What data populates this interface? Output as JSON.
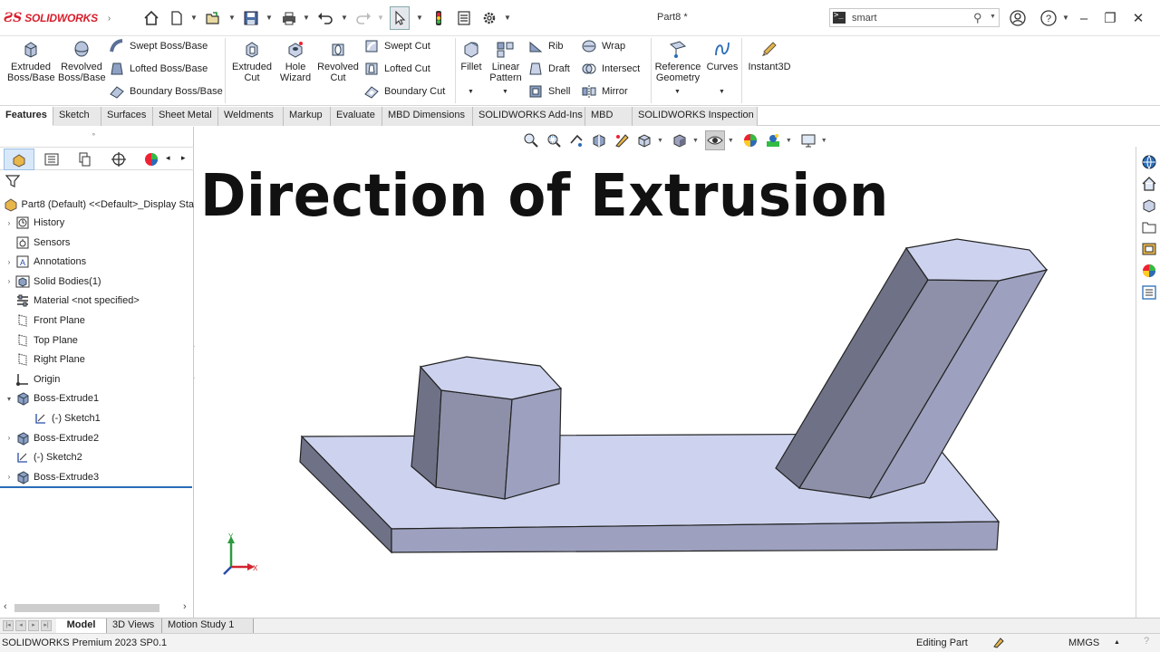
{
  "app": {
    "brand": "SOLIDWORKS",
    "doc_title": "Part8 *"
  },
  "search": {
    "value": "smart"
  },
  "ribbon": {
    "extruded_boss": "Extruded\nBoss/Base",
    "revolved_boss": "Revolved\nBoss/Base",
    "swept_boss": "Swept Boss/Base",
    "lofted_boss": "Lofted Boss/Base",
    "boundary_boss": "Boundary Boss/Base",
    "extruded_cut": "Extruded\nCut",
    "hole_wizard": "Hole\nWizard",
    "revolved_cut": "Revolved\nCut",
    "swept_cut": "Swept Cut",
    "lofted_cut": "Lofted Cut",
    "boundary_cut": "Boundary Cut",
    "fillet": "Fillet",
    "linear_pattern": "Linear\nPattern",
    "rib": "Rib",
    "draft": "Draft",
    "shell": "Shell",
    "wrap": "Wrap",
    "intersect": "Intersect",
    "mirror": "Mirror",
    "reference_geometry": "Reference\nGeometry",
    "curves": "Curves",
    "instant3d": "Instant3D"
  },
  "tabs": [
    "Features",
    "Sketch",
    "Surfaces",
    "Sheet Metal",
    "Weldments",
    "Markup",
    "Evaluate",
    "MBD Dimensions",
    "SOLIDWORKS Add-Ins",
    "MBD",
    "SOLIDWORKS Inspection"
  ],
  "tree": {
    "root": "Part8 (Default) <<Default>_Display Sta",
    "items": [
      {
        "label": "History",
        "icon": "history-icon",
        "expandable": true
      },
      {
        "label": "Sensors",
        "icon": "sensors-icon",
        "expandable": false
      },
      {
        "label": "Annotations",
        "icon": "annotations-icon",
        "expandable": true
      },
      {
        "label": "Solid Bodies(1)",
        "icon": "solid-bodies-icon",
        "expandable": true
      },
      {
        "label": "Material <not specified>",
        "icon": "material-icon",
        "expandable": false
      },
      {
        "label": "Front Plane",
        "icon": "plane-icon",
        "expandable": false
      },
      {
        "label": "Top Plane",
        "icon": "plane-icon",
        "expandable": false
      },
      {
        "label": "Right Plane",
        "icon": "plane-icon",
        "expandable": false
      },
      {
        "label": "Origin",
        "icon": "origin-icon",
        "expandable": false
      },
      {
        "label": "Boss-Extrude1",
        "icon": "extrude-icon",
        "expandable": true,
        "expanded": true
      },
      {
        "label": "(-) Sketch1",
        "icon": "sketch-icon",
        "expandable": false,
        "child": true
      },
      {
        "label": "Boss-Extrude2",
        "icon": "extrude-icon",
        "expandable": true
      },
      {
        "label": "(-) Sketch2",
        "icon": "sketch-icon",
        "expandable": false
      },
      {
        "label": "Boss-Extrude3",
        "icon": "extrude-icon",
        "expandable": true
      }
    ]
  },
  "viewport": {
    "heading": "Direction of Extrusion",
    "triad": {
      "x": "X",
      "y": "Y"
    }
  },
  "bottom_tabs": [
    "Model",
    "3D Views",
    "Motion Study 1"
  ],
  "status": {
    "product": "SOLIDWORKS Premium 2023 SP0.1",
    "mode": "Editing Part",
    "units": "MMGS"
  },
  "colors": {
    "brand_red": "#d81e2c",
    "model_face_light": "#cdd3ee",
    "model_face_mid": "#9da1bf",
    "model_face_dark": "#6c6f85",
    "selection_blue": "#2a6cb8"
  }
}
